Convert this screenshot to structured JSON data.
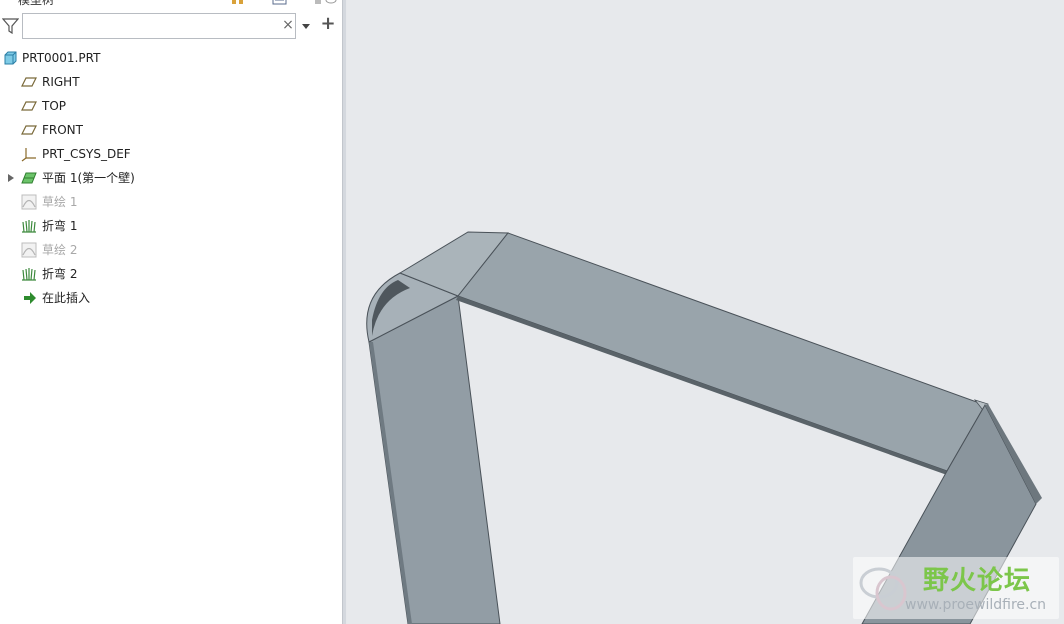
{
  "panel": {
    "title": "模型树",
    "search": {
      "value": "",
      "placeholder": ""
    },
    "clear_glyph": "×",
    "add_glyph": "+"
  },
  "tree": {
    "root": {
      "label": "PRT0001.PRT",
      "icon": "part-icon"
    },
    "items": [
      {
        "label": "RIGHT",
        "icon": "datum-plane-icon",
        "state": "normal"
      },
      {
        "label": "TOP",
        "icon": "datum-plane-icon",
        "state": "normal"
      },
      {
        "label": "FRONT",
        "icon": "datum-plane-icon",
        "state": "normal"
      },
      {
        "label": "PRT_CSYS_DEF",
        "icon": "coordinate-system-icon",
        "state": "normal"
      },
      {
        "label": "平面 1(第一个壁)",
        "icon": "planar-wall-icon",
        "state": "normal",
        "expandable": true
      },
      {
        "label": "草绘 1",
        "icon": "sketch-icon",
        "state": "suppressed"
      },
      {
        "label": "折弯 1",
        "icon": "bend-icon",
        "state": "normal"
      },
      {
        "label": "草绘 2",
        "icon": "sketch-icon",
        "state": "suppressed"
      },
      {
        "label": "折弯 2",
        "icon": "bend-icon",
        "state": "normal"
      },
      {
        "label": "在此插入",
        "icon": "insert-here-arrow-icon",
        "state": "normal"
      }
    ]
  },
  "watermark": {
    "title": "野火论坛",
    "url": "www.proewildfire.cn"
  },
  "colors": {
    "viewport_bg": "#e7e9ec",
    "sheet_face": "#98a3ab",
    "sheet_edge": "#6f7880",
    "insert_arrow": "#2e8b2e"
  }
}
